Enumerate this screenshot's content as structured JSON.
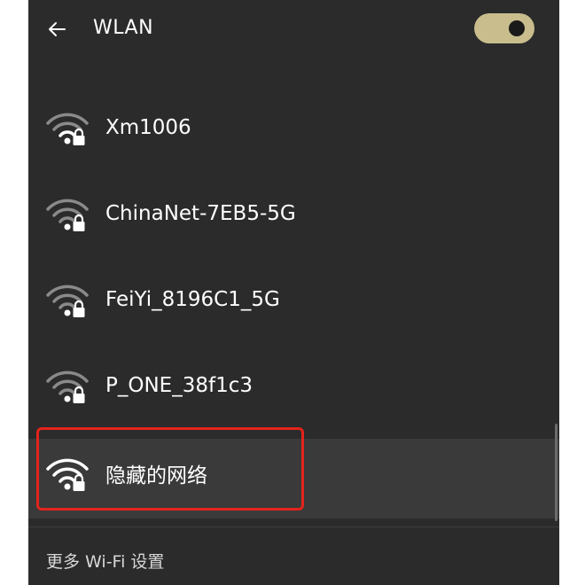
{
  "header": {
    "title": "WLAN",
    "back_icon": "arrow-left-icon",
    "toggle_state": "on",
    "toggle_color": "#c9bd8d"
  },
  "networks": [
    {
      "name": "Xm1006",
      "icon": "wifi-secured-icon",
      "signal": "weak"
    },
    {
      "name": "ChinaNet-7EB5-5G",
      "icon": "wifi-secured-icon",
      "signal": "weak"
    },
    {
      "name": "FeiYi_8196C1_5G",
      "icon": "wifi-secured-icon",
      "signal": "weak"
    },
    {
      "name": "P_ONE_38f1c3",
      "icon": "wifi-secured-icon",
      "signal": "weak"
    },
    {
      "name": "隐藏的网络",
      "icon": "wifi-secured-icon",
      "signal": "strong",
      "highlighted": true
    }
  ],
  "footer": {
    "more_settings": "更多 Wi-Fi 设置"
  },
  "colors": {
    "panel_bg": "#2b2b2b",
    "highlight_border": "#e3241b",
    "selected_row_bg": "#3a3a3a"
  }
}
